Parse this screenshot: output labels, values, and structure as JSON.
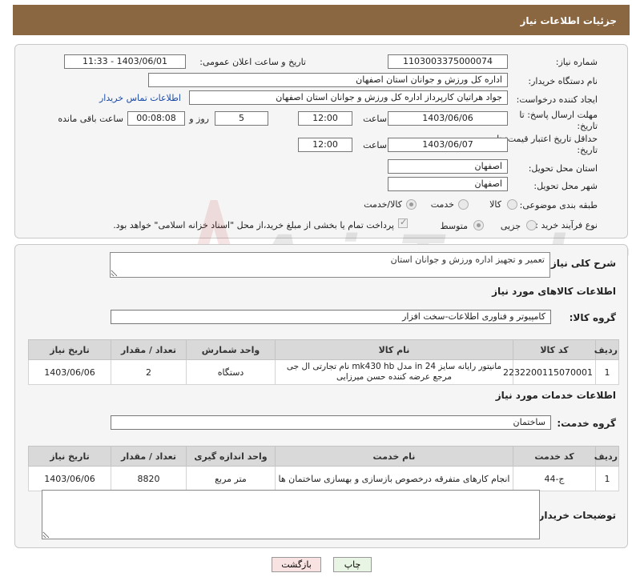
{
  "header": {
    "title": "جزئیات اطلاعات نیاز"
  },
  "form": {
    "need_number": {
      "label": "شماره نیاز:",
      "value": "1103003375000074"
    },
    "announce": {
      "label": "تاریخ و ساعت اعلان عمومی:",
      "value": "1403/06/01 - 11:33"
    },
    "buyer_org": {
      "label": "نام دستگاه خریدار:",
      "value": "اداره کل ورزش و جوانان استان اصفهان"
    },
    "requester": {
      "label": "ایجاد کننده درخواست:",
      "value": "جواد هراتیان کارپرداز اداره کل ورزش و جوانان استان اصفهان",
      "contact_link": "اطلاعات تماس خریدار"
    },
    "deadline": {
      "label_line1": "مهلت ارسال پاسخ: تا",
      "label_line2": "تاریخ:",
      "date": "1403/06/06",
      "time_label": "ساعت",
      "time": "12:00",
      "days": "5",
      "days_label": "روز و",
      "remaining": "00:08:08",
      "remaining_label": "ساعت باقی مانده"
    },
    "validity": {
      "label_line1": "حداقل تاریخ اعتبار قیمت: تا",
      "label_line2": "تاریخ:",
      "date": "1403/06/07",
      "time_label": "ساعت",
      "time": "12:00"
    },
    "province": {
      "label": "استان محل تحویل:",
      "value": "اصفهان"
    },
    "city": {
      "label": "شهر محل تحویل:",
      "value": "اصفهان"
    },
    "category": {
      "label": "طبقه بندی موضوعی:",
      "options": [
        "کالا",
        "خدمت",
        "کالا/خدمت"
      ],
      "selected": "کالا/خدمت"
    },
    "process": {
      "label": "نوع فرآیند خرید :",
      "options": [
        "جزیی",
        "متوسط"
      ],
      "selected": "متوسط",
      "payment_note": "پرداخت تمام یا بخشی از مبلغ خرید،از محل \"اسناد خزانه اسلامی\" خواهد بود."
    }
  },
  "watermark": {
    "text": "AriaTender.neT"
  },
  "description": {
    "label": "شرح کلی نیاز:",
    "value": "تعمیر و تجهیز اداره ورزش و جوانان استان"
  },
  "goods": {
    "section_title": "اطلاعات کالاهای مورد نیاز",
    "group_label": "گروه کالا:",
    "group_value": "کامپیوتر و فناوری اطلاعات-سخت افزار",
    "columns": [
      "ردیف",
      "کد کالا",
      "نام کالا",
      "واحد شمارش",
      "تعداد / مقدار",
      "تاریخ نیاز"
    ],
    "rows": [
      {
        "row": "1",
        "code": "2232200115070001",
        "name": "مانیتور رایانه سایز 24 in مدل mk430 hb نام تجارتی ال جی مرجع عرضه کننده حسن میرزایی",
        "unit": "دستگاه",
        "qty": "2",
        "date": "1403/06/06"
      }
    ]
  },
  "services": {
    "section_title": "اطلاعات خدمات مورد نیاز",
    "group_label": "گروه خدمت:",
    "group_value": "ساختمان",
    "columns": [
      "ردیف",
      "کد خدمت",
      "نام خدمت",
      "واحد اندازه گیری",
      "تعداد / مقدار",
      "تاریخ نیاز"
    ],
    "rows": [
      {
        "row": "1",
        "code": "ج-44",
        "name": "انجام کارهای متفرقه درخصوص بازسازی و بهسازی ساختمان ها",
        "unit": "متر مربع",
        "qty": "8820",
        "date": "1403/06/06"
      }
    ]
  },
  "buyer_notes": {
    "label": "توضیحات خریدار:",
    "value": ""
  },
  "buttons": {
    "print": "چاپ",
    "back": "بازگشت"
  }
}
